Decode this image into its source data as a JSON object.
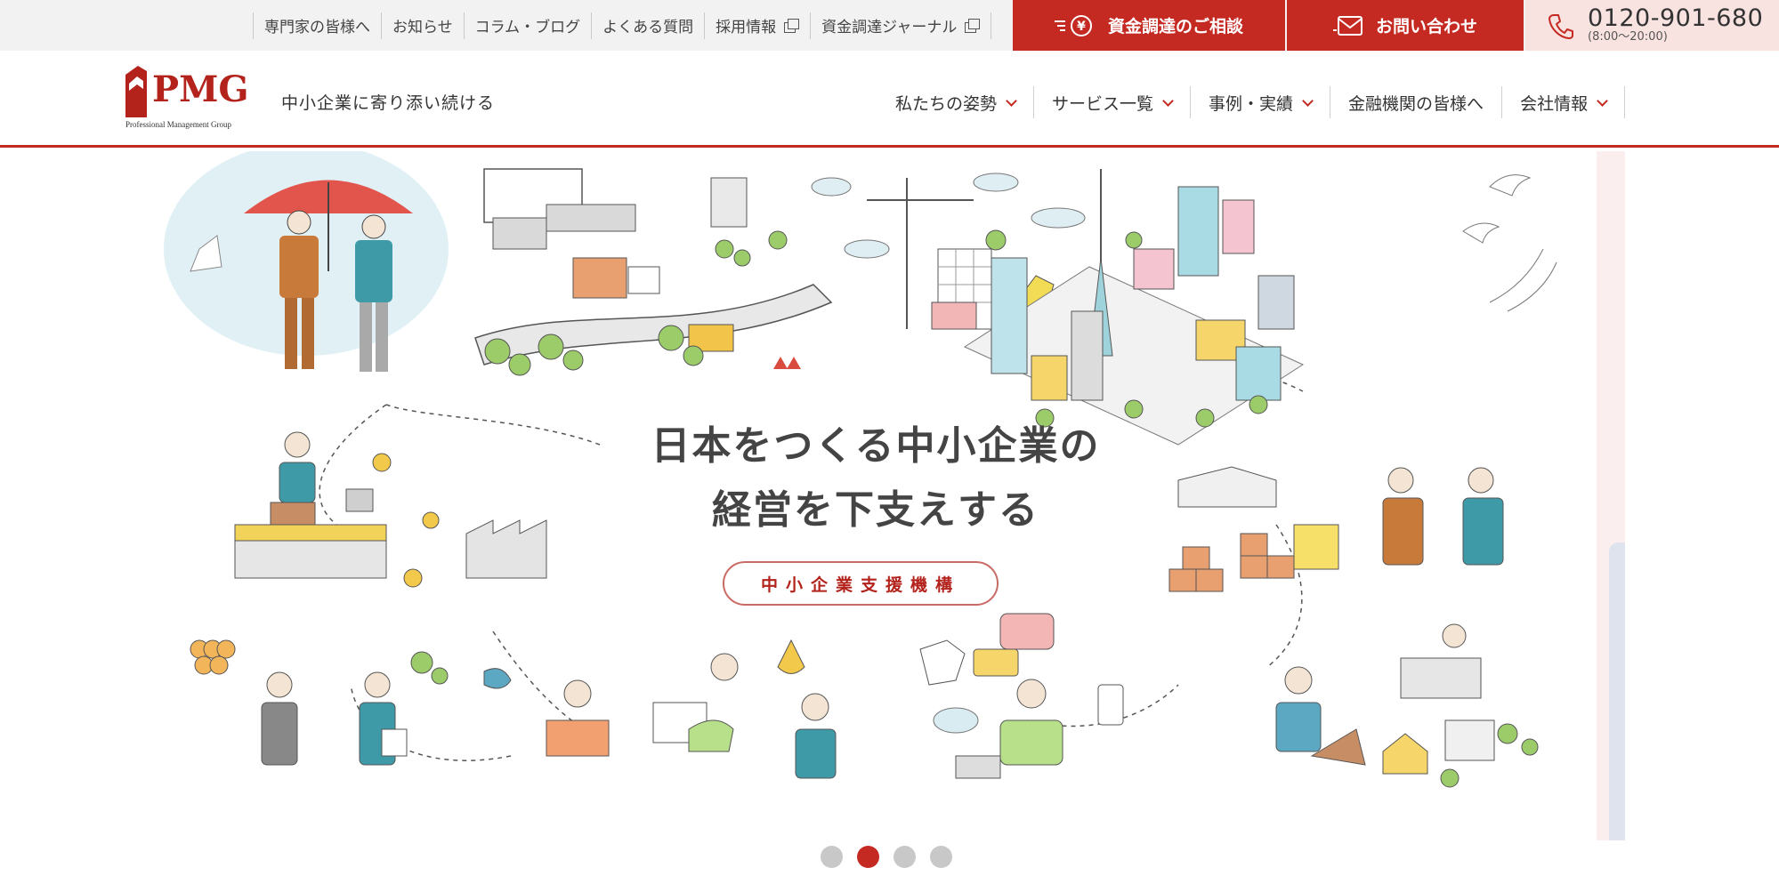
{
  "topbar": {
    "links": [
      {
        "label": "専門家の皆様へ",
        "external": false
      },
      {
        "label": "お知らせ",
        "external": false
      },
      {
        "label": "コラム・ブログ",
        "external": false
      },
      {
        "label": "よくある質問",
        "external": false
      },
      {
        "label": "採用情報",
        "external": true
      },
      {
        "label": "資金調達ジャーナル",
        "external": true
      }
    ],
    "cta_fund_label": "資金調達のご相談",
    "cta_fund_icon": "yen-icon",
    "cta_contact_label": "お問い合わせ",
    "cta_contact_icon": "envelope-icon",
    "phone_number": "0120-901-680",
    "phone_hours": "(8:00〜20:00)",
    "phone_icon": "phone-icon"
  },
  "header": {
    "logo_text": "PMG",
    "logo_sub": "Professional Management Group",
    "tagline": "中小企業に寄り添い続ける",
    "nav": [
      {
        "label": "私たちの姿勢",
        "dropdown": true
      },
      {
        "label": "サービス一覧",
        "dropdown": true
      },
      {
        "label": "事例・実績",
        "dropdown": true
      },
      {
        "label": "金融機関の皆様へ",
        "dropdown": false
      },
      {
        "label": "会社情報",
        "dropdown": true
      }
    ]
  },
  "hero": {
    "title_line1": "日本をつくる中小企業の",
    "title_line2": "経営を下支えする",
    "badge": "中小企業支援機構",
    "illustration": "small-business-city-illustration"
  },
  "carousel": {
    "slide_count": 4,
    "active_index": 1
  },
  "colors": {
    "brand_red": "#c52a22",
    "phone_bg": "#f8e3e1",
    "topbar_bg": "#f2f2f2"
  }
}
